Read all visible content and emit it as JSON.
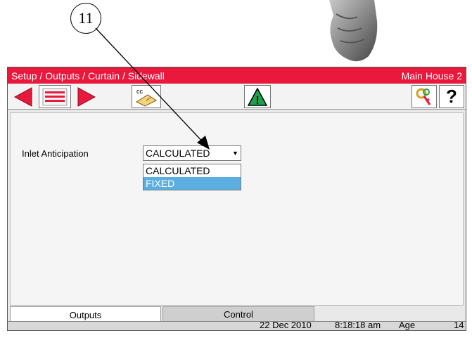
{
  "callout": {
    "number": "11"
  },
  "window": {
    "breadcrumb": "Setup / Outputs / Curtain / Sidewall",
    "house": "Main House 2"
  },
  "toolbar": {
    "icons": [
      "back-arrow-icon",
      "list-icon",
      "forward-arrow-icon",
      "cc-card-icon",
      "warning-icon",
      "key-icon",
      "help-icon"
    ],
    "cc_label": "cc",
    "help_label": "?",
    "warning_label": "!",
    "colors": {
      "arrow": "#e8193d",
      "warning": "#1aa14a"
    }
  },
  "form": {
    "inlet_label": "Inlet Anticipation",
    "inlet_value": "CALCULATED",
    "options": [
      "CALCULATED",
      "FIXED"
    ],
    "highlighted_option": "FIXED"
  },
  "tabs": [
    {
      "label": "Outputs",
      "active": true
    },
    {
      "label": "Control",
      "active": false
    }
  ],
  "status": {
    "date": "22 Dec 2010",
    "time": "8:18:18 am",
    "age_label": "Age",
    "age_value": "14"
  }
}
